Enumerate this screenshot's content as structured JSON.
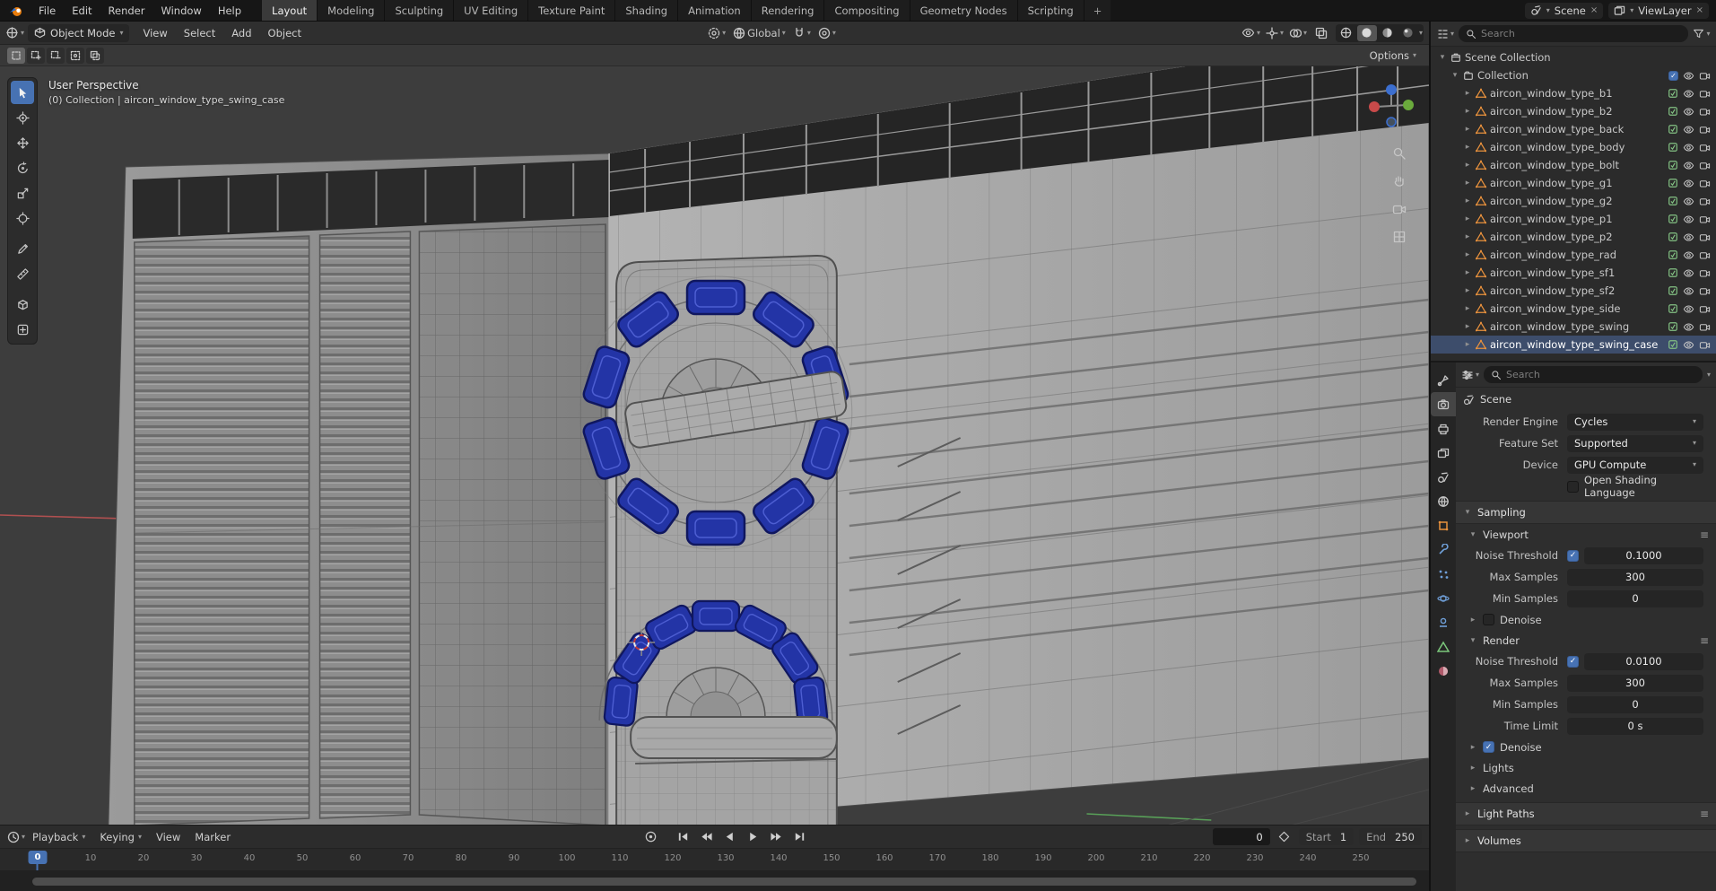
{
  "topbar": {
    "menus": [
      "File",
      "Edit",
      "Render",
      "Window",
      "Help"
    ],
    "workspaces": [
      {
        "label": "Layout",
        "active": true
      },
      {
        "label": "Modeling"
      },
      {
        "label": "Sculpting"
      },
      {
        "label": "UV Editing"
      },
      {
        "label": "Texture Paint"
      },
      {
        "label": "Shading"
      },
      {
        "label": "Animation"
      },
      {
        "label": "Rendering"
      },
      {
        "label": "Compositing"
      },
      {
        "label": "Geometry Nodes"
      },
      {
        "label": "Scripting"
      }
    ],
    "add_tab": "+",
    "scene_label": "Scene",
    "view_layer_label": "ViewLayer",
    "unlink_glyph": "×"
  },
  "header": {
    "mode": "Object Mode",
    "menus": [
      "View",
      "Select",
      "Add",
      "Object"
    ],
    "orientation": "Global"
  },
  "tool_settings": {
    "options_label": "Options"
  },
  "viewport": {
    "perspective_label": "User Perspective",
    "collection_label": "(0) Collection | aircon_window_type_swing_case"
  },
  "outliner": {
    "search_placeholder": "Search",
    "scene_collection_label": "Scene Collection",
    "collection_label": "Collection",
    "items": [
      {
        "name": "aircon_window_type_b1"
      },
      {
        "name": "aircon_window_type_b2"
      },
      {
        "name": "aircon_window_type_back"
      },
      {
        "name": "aircon_window_type_body"
      },
      {
        "name": "aircon_window_type_bolt"
      },
      {
        "name": "aircon_window_type_g1"
      },
      {
        "name": "aircon_window_type_g2"
      },
      {
        "name": "aircon_window_type_p1"
      },
      {
        "name": "aircon_window_type_p2"
      },
      {
        "name": "aircon_window_type_rad"
      },
      {
        "name": "aircon_window_type_sf1"
      },
      {
        "name": "aircon_window_type_sf2"
      },
      {
        "name": "aircon_window_type_side"
      },
      {
        "name": "aircon_window_type_swing"
      },
      {
        "name": "aircon_window_type_swing_case",
        "selected": true
      }
    ]
  },
  "properties": {
    "search_placeholder": "Search",
    "breadcrumb": "Scene",
    "render_engine_label": "Render Engine",
    "render_engine": "Cycles",
    "feature_set_label": "Feature Set",
    "feature_set": "Supported",
    "device_label": "Device",
    "device": "GPU Compute",
    "osl_label": "Open Shading Language",
    "sampling_label": "Sampling",
    "viewport_panel": {
      "title": "Viewport",
      "noise_threshold_label": "Noise Threshold",
      "noise_threshold": "0.1000",
      "max_samples_label": "Max Samples",
      "max_samples": "300",
      "min_samples_label": "Min Samples",
      "min_samples": "0",
      "denoise_label": "Denoise"
    },
    "render_panel": {
      "title": "Render",
      "noise_threshold_label": "Noise Threshold",
      "noise_threshold": "0.0100",
      "max_samples_label": "Max Samples",
      "max_samples": "300",
      "min_samples_label": "Min Samples",
      "min_samples": "0",
      "time_limit_label": "Time Limit",
      "time_limit": "0 s",
      "denoise_label": "Denoise"
    },
    "lights_label": "Lights",
    "advanced_label": "Advanced",
    "light_paths_label": "Light Paths",
    "volumes_label": "Volumes"
  },
  "timeline": {
    "menus": [
      "Playback",
      "Keying",
      "View",
      "Marker"
    ],
    "current_frame": "0",
    "playhead_label": "0",
    "start_label": "Start",
    "start_value": "1",
    "end_label": "End",
    "end_value": "250",
    "ticks": [
      "0",
      "10",
      "20",
      "30",
      "40",
      "50",
      "60",
      "70",
      "80",
      "90",
      "100",
      "110",
      "120",
      "130",
      "140",
      "150",
      "160",
      "170",
      "180",
      "190",
      "200",
      "210",
      "220",
      "230",
      "240",
      "250"
    ]
  }
}
